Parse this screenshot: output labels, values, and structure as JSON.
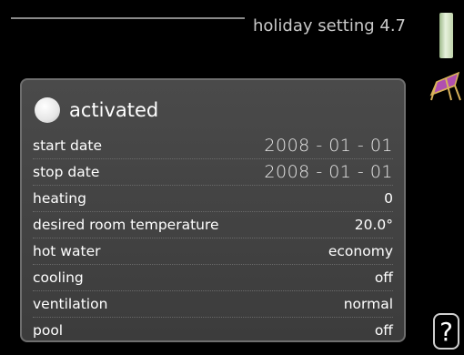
{
  "header": {
    "title": "holiday setting 4.7"
  },
  "activation": {
    "label": "activated",
    "checked": false
  },
  "settings": [
    {
      "label": "start date",
      "value": "2008 - 01 - 01"
    },
    {
      "label": "stop date",
      "value": "2008 - 01 - 01"
    },
    {
      "label": "heating",
      "value": "0"
    },
    {
      "label": "desired room temperature",
      "value": "20.0°"
    },
    {
      "label": "hot water",
      "value": "economy"
    },
    {
      "label": "cooling",
      "value": "off"
    },
    {
      "label": "ventilation",
      "value": "normal"
    },
    {
      "label": "pool",
      "value": "off"
    }
  ],
  "help": {
    "label": "?"
  },
  "icons": {
    "menu_icon": "deck-chair-icon",
    "scroll_indicator": "scroll-indicator"
  },
  "colors": {
    "background": "#000000",
    "panel": "#444444",
    "scroll_indicator": "#cfe0bf",
    "holiday_icon": "#b04fb0"
  }
}
